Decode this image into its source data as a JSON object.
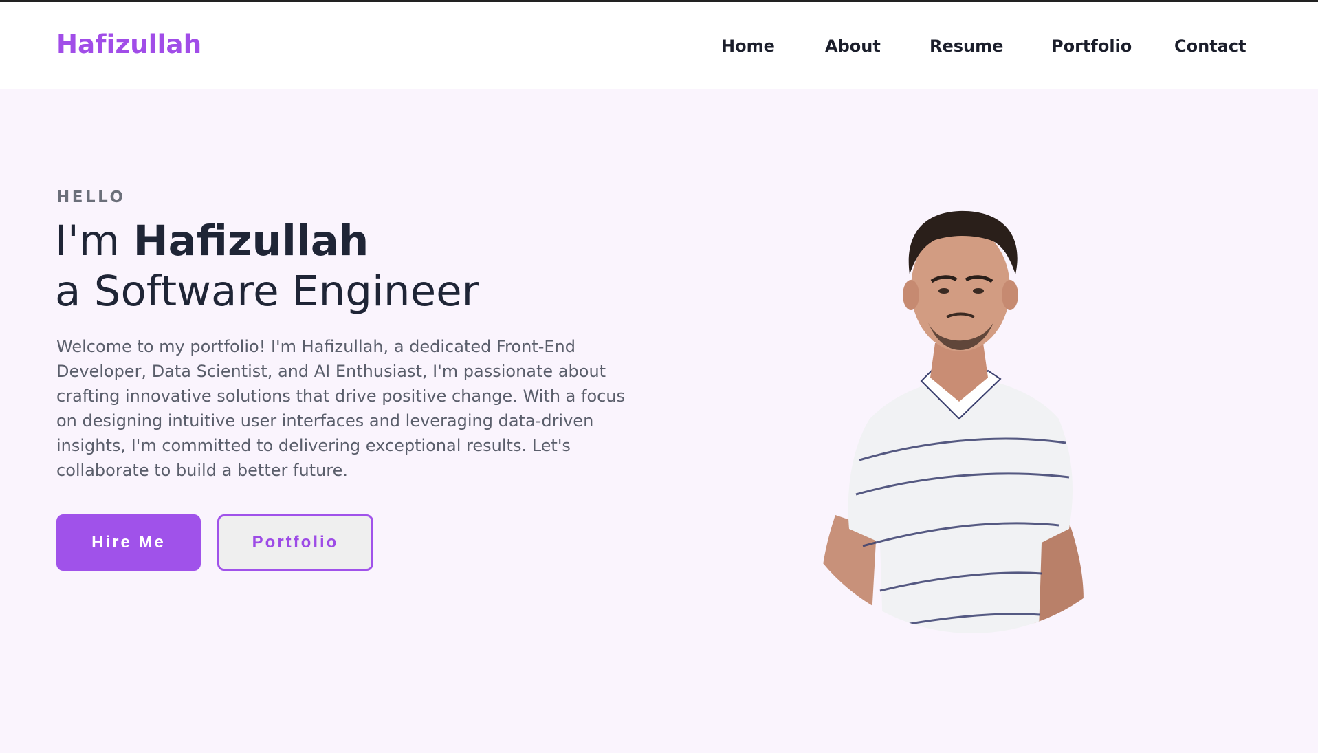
{
  "brand": {
    "name": "Hafizullah",
    "accent": "#a052ea"
  },
  "nav": {
    "items": [
      {
        "label": "Home"
      },
      {
        "label": "About"
      },
      {
        "label": "Resume"
      },
      {
        "label": "Portfolio"
      },
      {
        "label": "Contact"
      }
    ]
  },
  "hero": {
    "eyebrow": "HELLO",
    "greeting_prefix": "I'm ",
    "name": "Hafizullah",
    "role_line": "a Software Engineer",
    "intro": "Welcome to my portfolio! I'm Hafizullah, a dedicated Front-End Developer, Data Scientist, and AI Enthusiast, I'm passionate about crafting innovative solutions that drive positive change. With a focus on designing intuitive user interfaces and leveraging data-driven insights, I'm committed to delivering exceptional results. Let's collaborate to build a better future.",
    "primary_button": "Hire Me",
    "secondary_button": "Portfolio"
  },
  "colors": {
    "page_bg": "#faf4fd",
    "nav_bg": "#ffffff",
    "text_dark": "#1f2536",
    "text_muted": "#5a5e6b"
  }
}
